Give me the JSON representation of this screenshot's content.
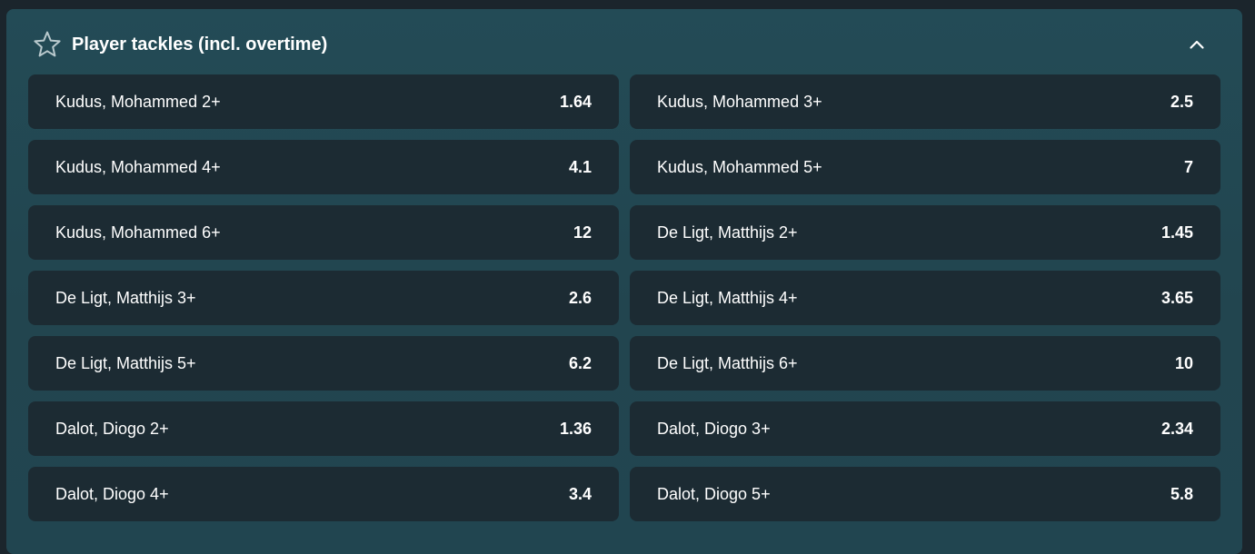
{
  "market": {
    "title": "Player tackles (incl. overtime)",
    "icons": {
      "favorite": "star-outline-icon",
      "collapse": "chevron-up-icon"
    },
    "colors": {
      "page_background": "#1b252c",
      "panel_background": "#234b56",
      "outcome_background": "#1c2b33",
      "text": "#ffffff",
      "icon_stroke": "#b9c9cd"
    },
    "outcomes": [
      {
        "label": "Kudus, Mohammed 2+",
        "odds": "1.64"
      },
      {
        "label": "Kudus, Mohammed 3+",
        "odds": "2.5"
      },
      {
        "label": "Kudus, Mohammed 4+",
        "odds": "4.1"
      },
      {
        "label": "Kudus, Mohammed 5+",
        "odds": "7"
      },
      {
        "label": "Kudus, Mohammed 6+",
        "odds": "12"
      },
      {
        "label": "De Ligt, Matthijs 2+",
        "odds": "1.45"
      },
      {
        "label": "De Ligt, Matthijs 3+",
        "odds": "2.6"
      },
      {
        "label": "De Ligt, Matthijs 4+",
        "odds": "3.65"
      },
      {
        "label": "De Ligt, Matthijs 5+",
        "odds": "6.2"
      },
      {
        "label": "De Ligt, Matthijs 6+",
        "odds": "10"
      },
      {
        "label": "Dalot, Diogo 2+",
        "odds": "1.36"
      },
      {
        "label": "Dalot, Diogo 3+",
        "odds": "2.34"
      },
      {
        "label": "Dalot, Diogo 4+",
        "odds": "3.4"
      },
      {
        "label": "Dalot, Diogo 5+",
        "odds": "5.8"
      }
    ]
  }
}
